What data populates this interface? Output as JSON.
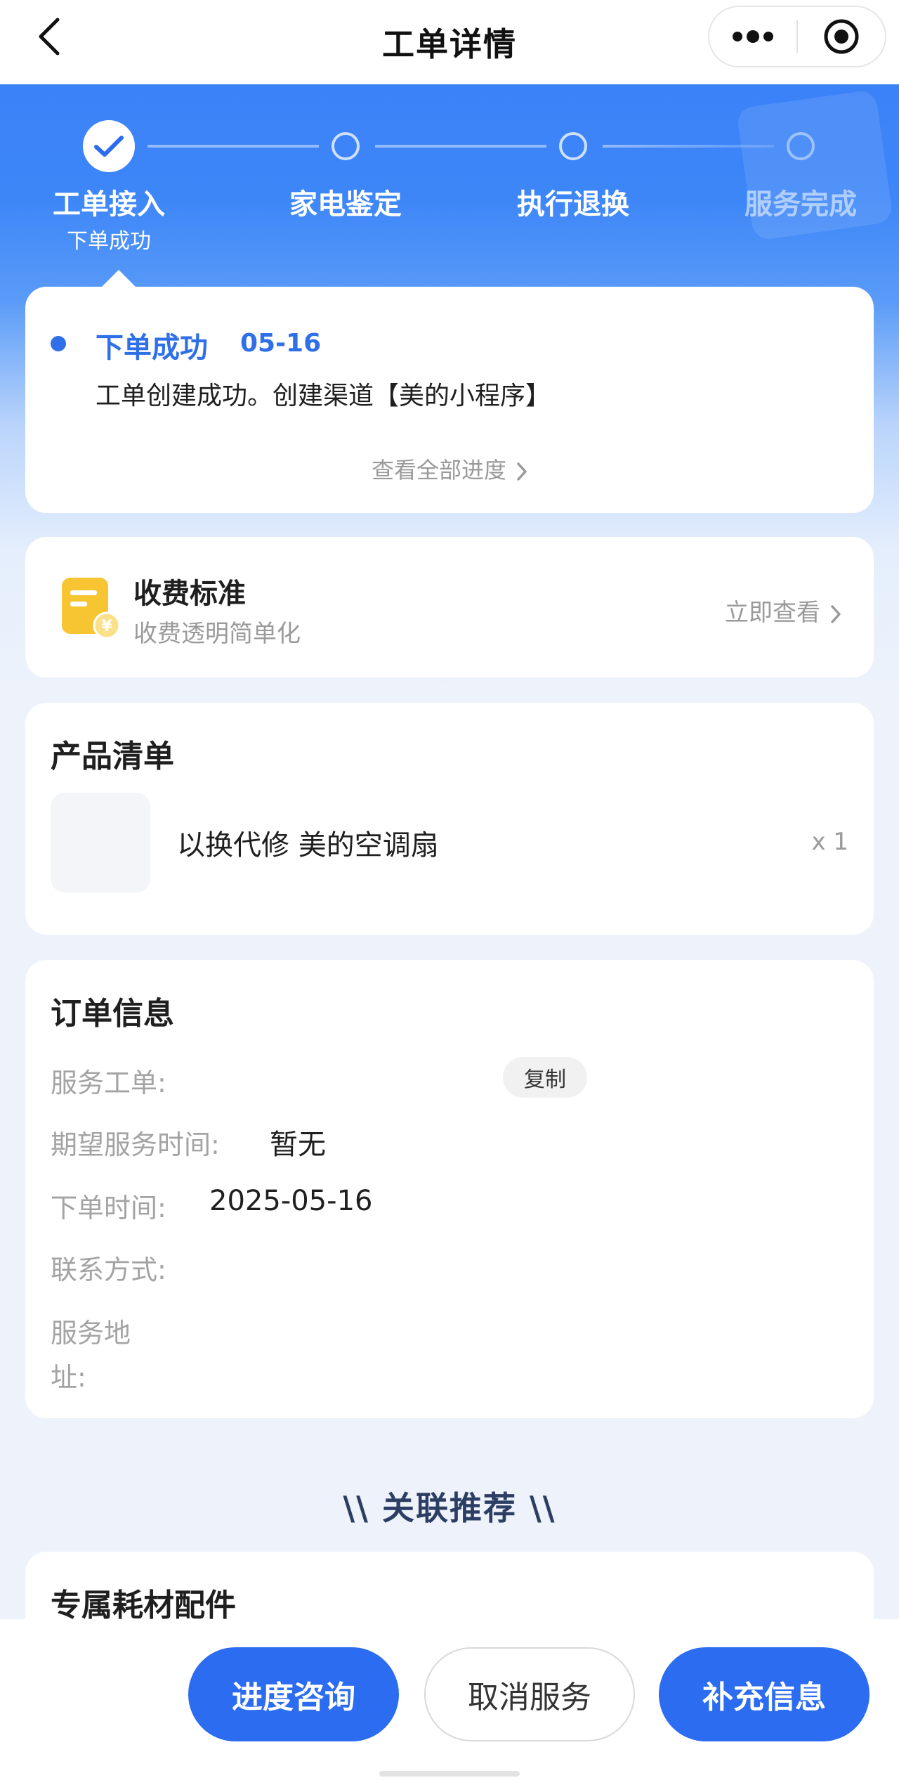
{
  "navbar": {
    "title": "工单详情",
    "back_icon": "chevron-left-icon",
    "more_icon": "more-dots-icon",
    "close_icon": "target-circle-icon"
  },
  "steps": [
    {
      "label": "工单接入",
      "sub": "下单成功",
      "status": "done"
    },
    {
      "label": "家电鉴定",
      "status": "pending"
    },
    {
      "label": "执行退换",
      "status": "pending"
    },
    {
      "label": "服务完成",
      "status": "pending"
    }
  ],
  "progress": {
    "title": "下单成功",
    "date": "05-16",
    "description": "工单创建成功。创建渠道【美的小程序】",
    "view_all": "查看全部进度"
  },
  "fee": {
    "title": "收费标准",
    "subtitle": "收费透明简单化",
    "link": "立即查看"
  },
  "products": {
    "title": "产品清单",
    "items": [
      {
        "name": "以换代修 美的空调扇",
        "qty": "x 1"
      }
    ]
  },
  "order": {
    "title": "订单信息",
    "service_no_label": "服务工单:",
    "copy_label": "复制",
    "expected_time_label": "期望服务时间:",
    "expected_time_value": "暂无",
    "order_time_label": "下单时间:",
    "order_time_value": "2025-05-16",
    "contact_label": "联系方式:",
    "address_label_line1": "服务地",
    "address_label_line2": "址:"
  },
  "recommend": {
    "title": "\\\\ 关联推荐 \\\\",
    "section_title": "专属耗材配件"
  },
  "bottom_buttons": {
    "consult": "进度咨询",
    "cancel": "取消服务",
    "supplement": "补充信息"
  },
  "colors": {
    "brand_blue": "#2b6cf0",
    "header_blue": "#3b82f8",
    "link_gray": "#9a9a9a",
    "fee_icon_yellow": "#f7c531"
  }
}
